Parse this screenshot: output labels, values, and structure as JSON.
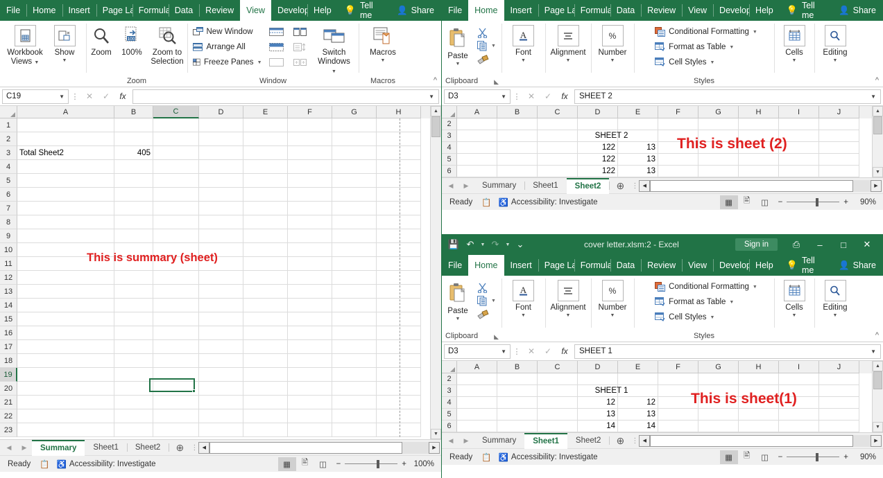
{
  "window_left": {
    "ribbon_tabs": [
      {
        "label": "File",
        "active": false
      },
      {
        "label": "Home",
        "active": false
      },
      {
        "label": "Insert",
        "active": false
      },
      {
        "label": "Page Lay",
        "active": false
      },
      {
        "label": "Formula",
        "active": false
      },
      {
        "label": "Data",
        "active": false
      },
      {
        "label": "Review",
        "active": false
      },
      {
        "label": "View",
        "active": true
      },
      {
        "label": "Develop",
        "active": false
      },
      {
        "label": "Help",
        "active": false
      }
    ],
    "tell_me": "Tell me",
    "share": "Share",
    "ribbon": {
      "groups": [
        {
          "label": "",
          "buttons": [
            {
              "label": "Workbook\nViews",
              "icon": "workbook-views-icon",
              "has_caret": true
            },
            {
              "label": "Show",
              "icon": "show-icon",
              "has_caret": true
            }
          ]
        },
        {
          "label": "Zoom",
          "buttons": [
            {
              "label": "Zoom",
              "icon": "magnifier-icon",
              "has_caret": false
            },
            {
              "label": "100%",
              "icon": "zoom-100-icon",
              "has_caret": false
            },
            {
              "label": "Zoom to\nSelection",
              "icon": "zoom-to-selection-icon",
              "has_caret": false
            }
          ]
        },
        {
          "label": "Window",
          "small_items": [
            {
              "label": "New Window",
              "icon": "new-window-icon"
            },
            {
              "label": "Arrange All",
              "icon": "arrange-all-icon"
            },
            {
              "label": "Freeze Panes",
              "icon": "freeze-panes-icon",
              "has_caret": true
            }
          ],
          "split_items": [
            "split-icon",
            "hide-icon",
            "unhide-icon",
            "view-side-by-side-icon",
            "synchronous-scrolling-icon",
            "reset-window-position-icon"
          ],
          "buttons": [
            {
              "label": "Switch\nWindows",
              "icon": "switch-windows-icon",
              "has_caret": true
            }
          ]
        },
        {
          "label": "Macros",
          "buttons": [
            {
              "label": "Macros",
              "icon": "macros-icon",
              "has_caret": true
            }
          ]
        }
      ]
    },
    "formula_bar": {
      "name_box": "C19",
      "formula": ""
    },
    "grid": {
      "columns": [
        "A",
        "B",
        "C",
        "D",
        "E",
        "F",
        "G",
        "H"
      ],
      "selected_column": "C",
      "rows": [
        "1",
        "2",
        "3",
        "4",
        "5",
        "6",
        "7",
        "8",
        "9",
        "10",
        "11",
        "12",
        "13",
        "14",
        "15",
        "16",
        "17",
        "18",
        "19",
        "20",
        "21",
        "22",
        "23"
      ],
      "selected_row": "19",
      "cell_values": [
        {
          "row": "3",
          "col": "A",
          "value": "Total  Sheet2",
          "align": "left"
        },
        {
          "row": "3",
          "col": "B",
          "value": "405",
          "align": "right"
        }
      ],
      "overlay_text": "This is summary (sheet)",
      "selection": "C19"
    },
    "sheet_tabs": [
      {
        "label": "Summary",
        "active": true
      },
      {
        "label": "Sheet1",
        "active": false
      },
      {
        "label": "Sheet2",
        "active": false
      }
    ],
    "status": {
      "ready": "Ready",
      "accessibility": "Accessibility: Investigate",
      "zoom": "100%"
    }
  },
  "window_mid": {
    "ribbon_tabs": [
      {
        "label": "File",
        "active": false
      },
      {
        "label": "Home",
        "active": true
      },
      {
        "label": "Insert",
        "active": false
      },
      {
        "label": "Page Lay",
        "active": false
      },
      {
        "label": "Formula",
        "active": false
      },
      {
        "label": "Data",
        "active": false
      },
      {
        "label": "Review",
        "active": false
      },
      {
        "label": "View",
        "active": false
      },
      {
        "label": "Develop",
        "active": false
      },
      {
        "label": "Help",
        "active": false
      }
    ],
    "tell_me": "Tell me",
    "share": "Share",
    "ribbon": {
      "clipboard": {
        "label": "Clipboard",
        "paste": "Paste",
        "items": [
          "cut-icon",
          "copy-icon",
          "format-painter-icon"
        ]
      },
      "groups": [
        {
          "label": "Font",
          "icon": "font-A-icon"
        },
        {
          "label": "Alignment",
          "icon": "alignment-icon"
        },
        {
          "label": "Number",
          "icon": "percent-icon"
        }
      ],
      "styles": {
        "label": "Styles",
        "items": [
          {
            "label": "Conditional Formatting",
            "icon": "conditional-formatting-icon",
            "has_caret": true
          },
          {
            "label": "Format as Table",
            "icon": "format-as-table-icon",
            "has_caret": true
          },
          {
            "label": "Cell Styles",
            "icon": "cell-styles-icon",
            "has_caret": true
          }
        ]
      },
      "cells": {
        "label": "Cells",
        "icon": "cells-icon"
      },
      "editing": {
        "label": "Editing",
        "icon": "editing-icon"
      }
    },
    "formula_bar": {
      "name_box": "D3",
      "formula": "SHEET 2"
    },
    "grid": {
      "columns": [
        "A",
        "B",
        "C",
        "D",
        "E",
        "F",
        "G",
        "H",
        "I",
        "J"
      ],
      "rows": [
        "2",
        "3",
        "4",
        "5",
        "6"
      ],
      "cell_values": [
        {
          "row": "3",
          "col": "D",
          "value": "SHEET 2",
          "align": "center-merge"
        },
        {
          "row": "4",
          "col": "D",
          "value": "122",
          "align": "right"
        },
        {
          "row": "4",
          "col": "E",
          "value": "13",
          "align": "right"
        },
        {
          "row": "5",
          "col": "D",
          "value": "122",
          "align": "right"
        },
        {
          "row": "5",
          "col": "E",
          "value": "13",
          "align": "right"
        },
        {
          "row": "6",
          "col": "D",
          "value": "122",
          "align": "right"
        },
        {
          "row": "6",
          "col": "E",
          "value": "13",
          "align": "right"
        }
      ],
      "overlay_text": "This is sheet (2)"
    },
    "sheet_tabs": [
      {
        "label": "Summary",
        "active": false
      },
      {
        "label": "Sheet1",
        "active": false
      },
      {
        "label": "Sheet2",
        "active": true
      }
    ],
    "status": {
      "ready": "Ready",
      "accessibility": "Accessibility: Investigate",
      "zoom": "90%"
    }
  },
  "window_bottom": {
    "title": "cover letter.xlsm:2  -  Excel",
    "sign_in": "Sign in",
    "quick_access": [
      "save-icon",
      "undo-icon",
      "redo-icon",
      "customize-qat-icon"
    ],
    "window_controls": [
      "ribbon-display-options-icon",
      "minimize-icon",
      "maximize-icon",
      "close-icon"
    ],
    "ribbon_tabs": [
      {
        "label": "File",
        "active": false
      },
      {
        "label": "Home",
        "active": true
      },
      {
        "label": "Insert",
        "active": false
      },
      {
        "label": "Page Lay",
        "active": false
      },
      {
        "label": "Formula",
        "active": false
      },
      {
        "label": "Data",
        "active": false
      },
      {
        "label": "Review",
        "active": false
      },
      {
        "label": "View",
        "active": false
      },
      {
        "label": "Develop",
        "active": false
      },
      {
        "label": "Help",
        "active": false
      }
    ],
    "tell_me": "Tell me",
    "share": "Share",
    "ribbon": {
      "clipboard": {
        "label": "Clipboard",
        "paste": "Paste",
        "items": [
          "cut-icon",
          "copy-icon",
          "format-painter-icon"
        ]
      },
      "groups": [
        {
          "label": "Font",
          "icon": "font-A-icon"
        },
        {
          "label": "Alignment",
          "icon": "alignment-icon"
        },
        {
          "label": "Number",
          "icon": "percent-icon"
        }
      ],
      "styles": {
        "label": "Styles",
        "items": [
          {
            "label": "Conditional Formatting",
            "icon": "conditional-formatting-icon",
            "has_caret": true
          },
          {
            "label": "Format as Table",
            "icon": "format-as-table-icon",
            "has_caret": true
          },
          {
            "label": "Cell Styles",
            "icon": "cell-styles-icon",
            "has_caret": true
          }
        ]
      },
      "cells": {
        "label": "Cells",
        "icon": "cells-icon"
      },
      "editing": {
        "label": "Editing",
        "icon": "editing-icon"
      }
    },
    "formula_bar": {
      "name_box": "D3",
      "formula": "SHEET 1"
    },
    "grid": {
      "columns": [
        "A",
        "B",
        "C",
        "D",
        "E",
        "F",
        "G",
        "H",
        "I",
        "J"
      ],
      "rows": [
        "2",
        "3",
        "4",
        "5",
        "6"
      ],
      "cell_values": [
        {
          "row": "3",
          "col": "D",
          "value": "SHEET 1",
          "align": "center-merge"
        },
        {
          "row": "4",
          "col": "D",
          "value": "12",
          "align": "right"
        },
        {
          "row": "4",
          "col": "E",
          "value": "12",
          "align": "right"
        },
        {
          "row": "5",
          "col": "D",
          "value": "13",
          "align": "right"
        },
        {
          "row": "5",
          "col": "E",
          "value": "13",
          "align": "right"
        },
        {
          "row": "6",
          "col": "D",
          "value": "14",
          "align": "right"
        },
        {
          "row": "6",
          "col": "E",
          "value": "14",
          "align": "right"
        }
      ],
      "overlay_text": "This is sheet(1)"
    },
    "sheet_tabs": [
      {
        "label": "Summary",
        "active": false
      },
      {
        "label": "Sheet1",
        "active": true
      },
      {
        "label": "Sheet2",
        "active": false
      }
    ],
    "status": {
      "ready": "Ready",
      "accessibility": "Accessibility: Investigate",
      "zoom": "90%"
    }
  },
  "colors": {
    "excel_green": "#217346",
    "red_note": "#e02020",
    "ribbon_bg": "#ffffff",
    "header_bg": "#f0f0f0"
  }
}
